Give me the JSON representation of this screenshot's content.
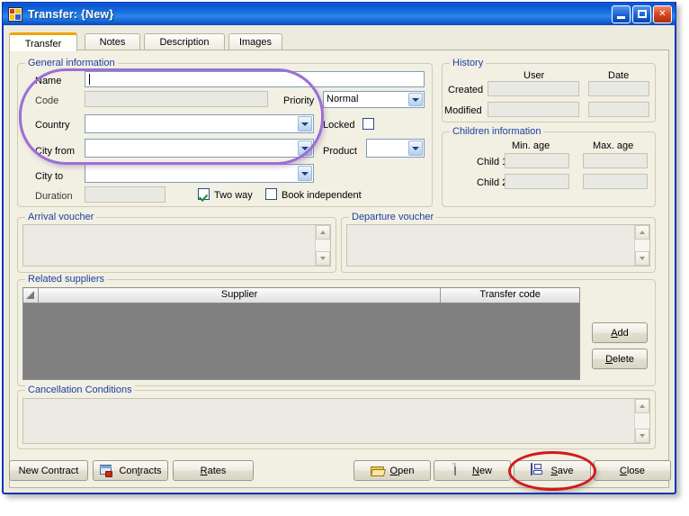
{
  "window": {
    "title": "Transfer: {New}",
    "icon": "form-icon",
    "buttons": {
      "minimize": "minimize-button",
      "maximize": "maximize-button",
      "close": "close-button"
    }
  },
  "tabs": [
    {
      "label": "Transfer",
      "active": true
    },
    {
      "label": "Notes",
      "active": false
    },
    {
      "label": "Description",
      "active": false
    },
    {
      "label": "Images",
      "active": false
    }
  ],
  "general": {
    "caption": "General information",
    "fields": {
      "name_label": "Name",
      "name_value": "",
      "code_label": "Code",
      "code_value": "",
      "country_label": "Country",
      "country_value": "",
      "cityfrom_label": "City from",
      "cityfrom_value": "",
      "cityto_label": "City to",
      "cityto_value": "",
      "duration_label": "Duration",
      "duration_value": "",
      "priority_label": "Priority",
      "priority_value": "Normal",
      "locked_label": "Locked",
      "locked_checked": false,
      "product_label": "Product",
      "product_value": ""
    },
    "checkboxes": {
      "twoway_label": "Two way",
      "twoway_checked": true,
      "bookind_label": "Book independent",
      "bookind_checked": false
    }
  },
  "history": {
    "caption": "History",
    "columns": [
      "User",
      "Date"
    ],
    "rows": [
      {
        "label": "Created",
        "user": "",
        "date": ""
      },
      {
        "label": "Modified",
        "user": "",
        "date": ""
      }
    ]
  },
  "children": {
    "caption": "Children information",
    "columns": [
      "Min. age",
      "Max. age"
    ],
    "rows": [
      {
        "label": "Child 1",
        "min": "",
        "max": ""
      },
      {
        "label": "Child 2",
        "min": "",
        "max": ""
      }
    ]
  },
  "arrival_voucher": {
    "caption": "Arrival voucher",
    "value": ""
  },
  "departure_voucher": {
    "caption": "Departure voucher",
    "value": ""
  },
  "related_suppliers": {
    "caption": "Related suppliers",
    "columns": [
      "Supplier",
      "Transfer code"
    ],
    "rows": [],
    "add_label": "Add",
    "delete_label": "Delete"
  },
  "cancellation": {
    "caption": "Cancellation Conditions",
    "value": ""
  },
  "footer": {
    "new_contract_label": "New Contract",
    "contracts_label": "Contracts",
    "rates_label": "Rates",
    "open_label": "Open",
    "new_label": "New",
    "save_label": "Save",
    "close_label": "Close"
  },
  "annotations": {
    "purple_highlight": "general-information-fields-highlight",
    "red_highlight": "save-button-highlight"
  },
  "colors": {
    "titlebar": "#1163d8",
    "group_caption": "#1b3fa0",
    "active_tab_accent": "#f0a30a",
    "highlight_purple": "#9b6fd4",
    "highlight_red": "#d11a1a",
    "grid_background": "#808080"
  }
}
